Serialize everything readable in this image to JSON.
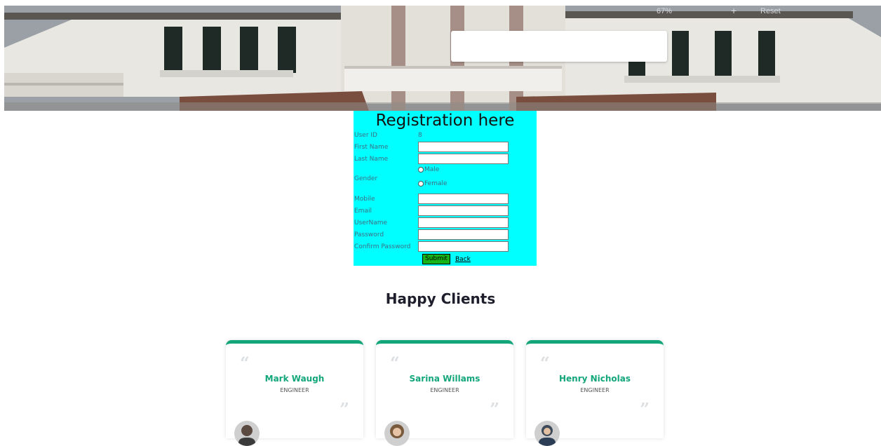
{
  "hero": {
    "zoom_level": "67%",
    "zoom_plus": "+",
    "zoom_reset": "Reset",
    "search_value": ""
  },
  "registration": {
    "title": "Registration here",
    "user_id_label": "User ID",
    "user_id_value": "8",
    "first_name_label": "First Name",
    "last_name_label": "Last Name",
    "gender_label": "Gender",
    "gender_options": [
      "Male",
      "Female"
    ],
    "mobile_label": "Mobile",
    "email_label": "Email",
    "username_label": "UserName",
    "password_label": "Password",
    "confirm_password_label": "Confirm Password",
    "submit_label": "Submit",
    "back_label": "Back"
  },
  "clients": {
    "title": "Happy Clients",
    "cards": [
      {
        "name": "Mark Waugh",
        "role": "ENGINEER"
      },
      {
        "name": "Sarina Willams",
        "role": "ENGINEER"
      },
      {
        "name": "Henry Nicholas",
        "role": "ENGINEER"
      }
    ]
  },
  "colors": {
    "form_background": "#00ffff",
    "accent_green": "#13a67a",
    "submit_green": "#17b417"
  },
  "icons": [
    "quote-open-icon",
    "quote-close-icon",
    "radio-icon"
  ]
}
